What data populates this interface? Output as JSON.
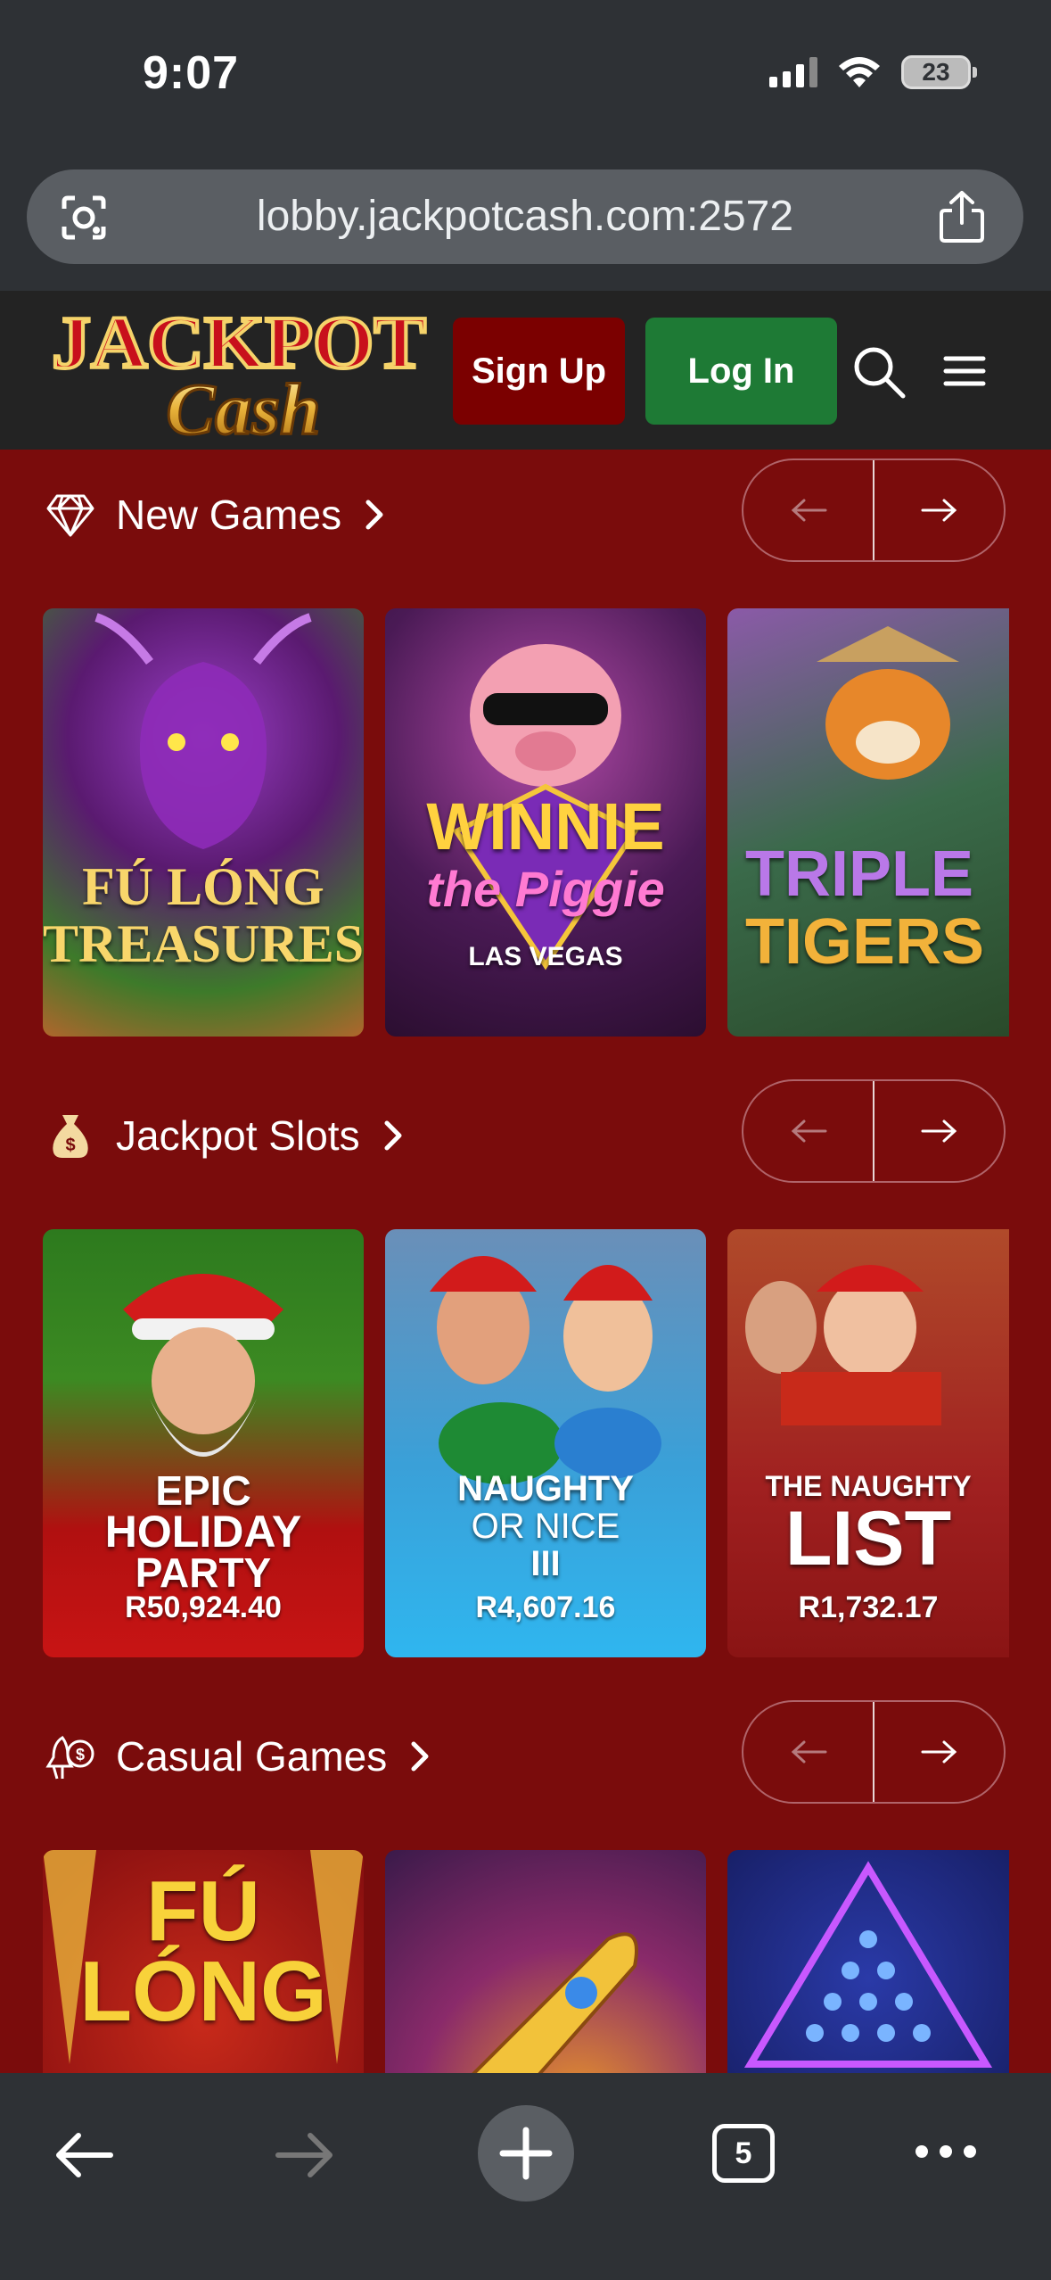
{
  "status_bar": {
    "time": "9:07",
    "battery": "23"
  },
  "browser": {
    "url": "lobby.jackpotcash.com:2572",
    "tab_count": "5"
  },
  "header": {
    "logo_text_top": "JACKPOT",
    "logo_text_bottom": "Cash",
    "signup_label": "Sign Up",
    "login_label": "Log In"
  },
  "sections": [
    {
      "title": "New Games",
      "icon": "diamond-icon",
      "games": [
        {
          "name_lines": [
            "FÚ LÓNG",
            "TREASURES"
          ],
          "jackpot": ""
        },
        {
          "name_lines": [
            "WINNIE",
            "the Piggie",
            "LAS VEGAS"
          ],
          "jackpot": ""
        },
        {
          "name_lines": [
            "TRIPLE",
            "TIGERS"
          ],
          "jackpot": ""
        }
      ]
    },
    {
      "title": "Jackpot Slots",
      "icon": "money-bag-icon",
      "games": [
        {
          "name_lines": [
            "EPIC",
            "HOLIDAY",
            "PARTY"
          ],
          "jackpot": "R50,924.40"
        },
        {
          "name_lines": [
            "NAUGHTY",
            "OR NICE",
            "III"
          ],
          "jackpot": "R4,607.16"
        },
        {
          "name_lines": [
            "THE NAUGHTY",
            "LIST"
          ],
          "jackpot": "R1,732.17"
        }
      ]
    },
    {
      "title": "Casual Games",
      "icon": "casual-games-icon",
      "games": [
        {
          "name_lines": [
            "FÚ",
            "LÓNG"
          ],
          "jackpot": ""
        },
        {
          "name_lines": [],
          "jackpot": ""
        },
        {
          "name_lines": [],
          "jackpot": ""
        }
      ]
    }
  ]
}
